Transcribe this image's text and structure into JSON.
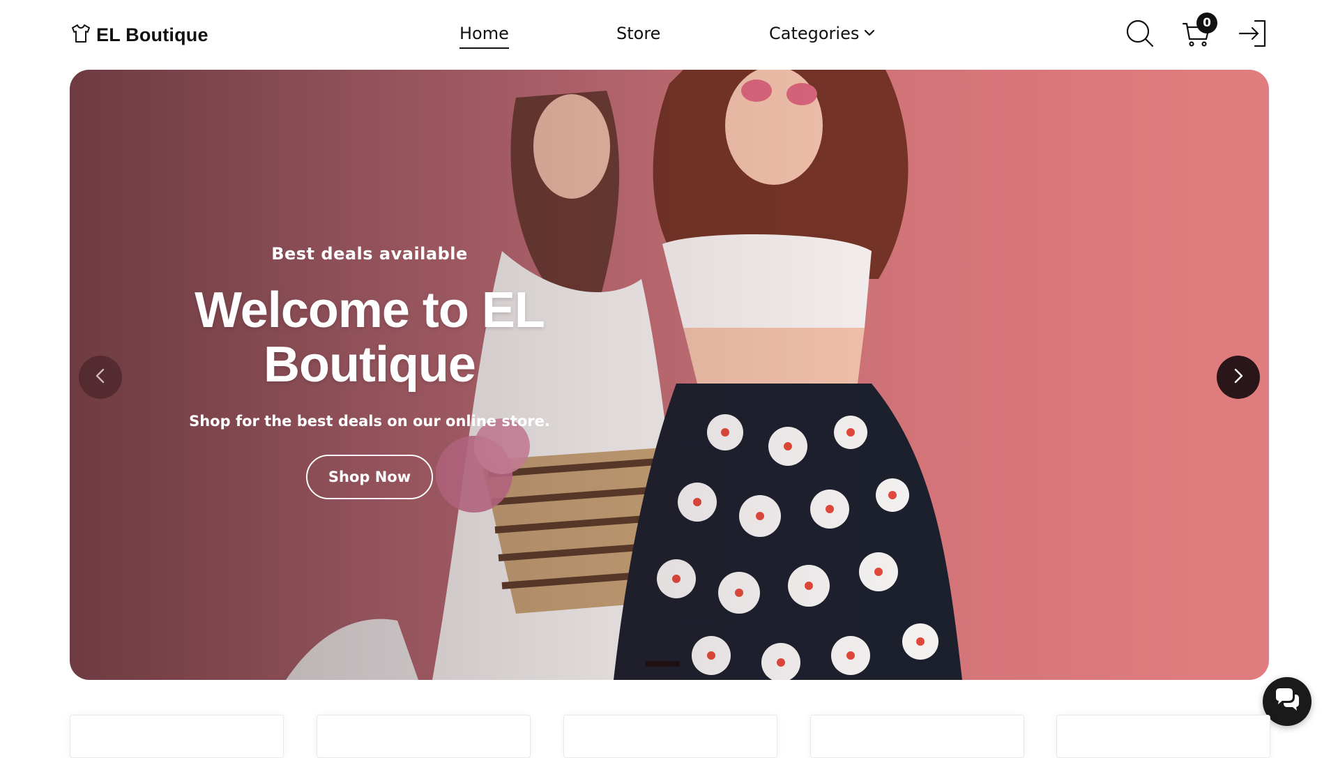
{
  "header": {
    "logo_text": "EL Boutique",
    "logo_icon": "tshirt-icon",
    "nav": {
      "home": "Home",
      "store": "Store",
      "categories": "Categories"
    },
    "cart_count": "0",
    "icons": [
      "search-icon",
      "cart-icon",
      "login-icon",
      "chevron-down-icon"
    ]
  },
  "hero": {
    "eyebrow": "Best deals available",
    "title_line1": "Welcome to EL",
    "title_line2": "Boutique",
    "subtitle": "Shop for the best deals on our online store.",
    "cta_label": "Shop Now",
    "slide_count": 1,
    "active_slide": 1
  },
  "colors": {
    "accent_dark": "#111111",
    "hero_pink": "#d8777a",
    "text_on_hero": "#ffffff"
  }
}
